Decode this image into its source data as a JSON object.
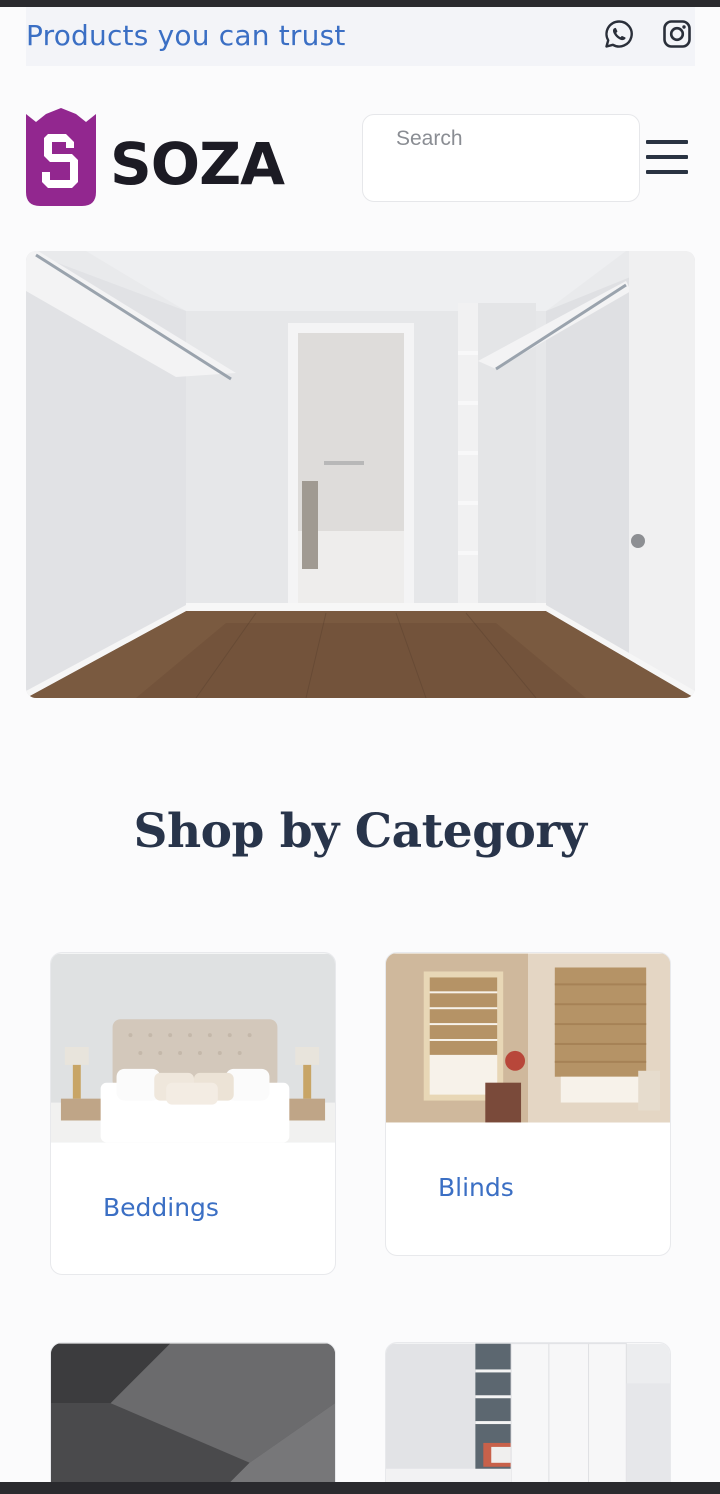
{
  "topbar": {
    "tagline": "Products you can trust",
    "social": [
      {
        "icon": "whatsapp-icon"
      },
      {
        "icon": "instagram-icon"
      }
    ]
  },
  "header": {
    "brand": "SOZA",
    "brand_color": "#92278f",
    "search": {
      "placeholder": "Search",
      "value": ""
    },
    "menu_icon": "hamburger-menu-icon"
  },
  "hero": {
    "image": "walk-in closet with white shelving and wood floor"
  },
  "categories": {
    "title": "Shop by Category",
    "items": [
      {
        "label": "Beddings"
      },
      {
        "label": "Blinds"
      },
      {
        "label": ""
      },
      {
        "label": ""
      }
    ]
  },
  "colors": {
    "accent": "#3b6fc4",
    "heading": "#28344a",
    "background": "#fbfbfc"
  }
}
